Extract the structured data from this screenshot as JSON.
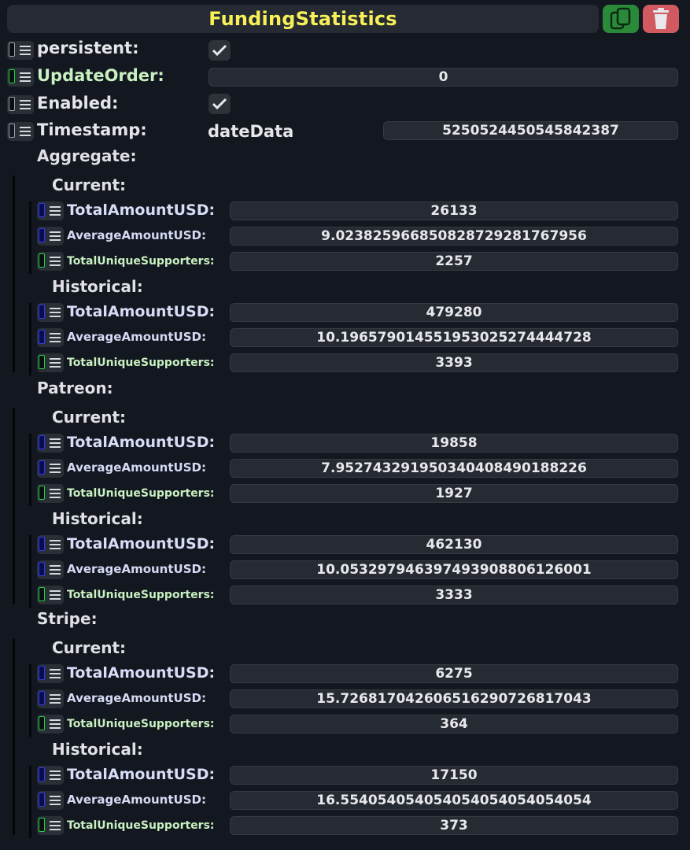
{
  "header": {
    "title": "FundingStatistics"
  },
  "fields": {
    "persistent": "persistent:",
    "update_order": "UpdateOrder:",
    "update_order_value": "0",
    "enabled": "Enabled:",
    "timestamp": "Timestamp:",
    "timestamp_type": "dateData",
    "timestamp_value": "5250524450545842387"
  },
  "labels": {
    "total": "TotalAmountUSD:",
    "average": "AverageAmountUSD:",
    "unique": "TotalUniqueSupporters:",
    "current": "Current:",
    "historical": "Historical:"
  },
  "sections": [
    {
      "title": "Aggregate:",
      "current": {
        "total": "26133",
        "average": "9.0238259668508287292817679​56",
        "unique": "2257"
      },
      "historical": {
        "total": "479280",
        "average": "10.196579014551953025274444728",
        "unique": "3393"
      }
    },
    {
      "title": "Patreon:",
      "current": {
        "total": "19858",
        "average": "7.9527432919503404084901882​26",
        "unique": "1927"
      },
      "historical": {
        "total": "462130",
        "average": "10.053297946397493908806126001",
        "unique": "3333"
      }
    },
    {
      "title": "Stripe:",
      "current": {
        "total": "6275",
        "average": "15.726817042606516290726817043",
        "unique": "364"
      },
      "historical": {
        "total": "17150",
        "average": "16.554054054054054054054054054",
        "unique": "373"
      }
    }
  ]
}
